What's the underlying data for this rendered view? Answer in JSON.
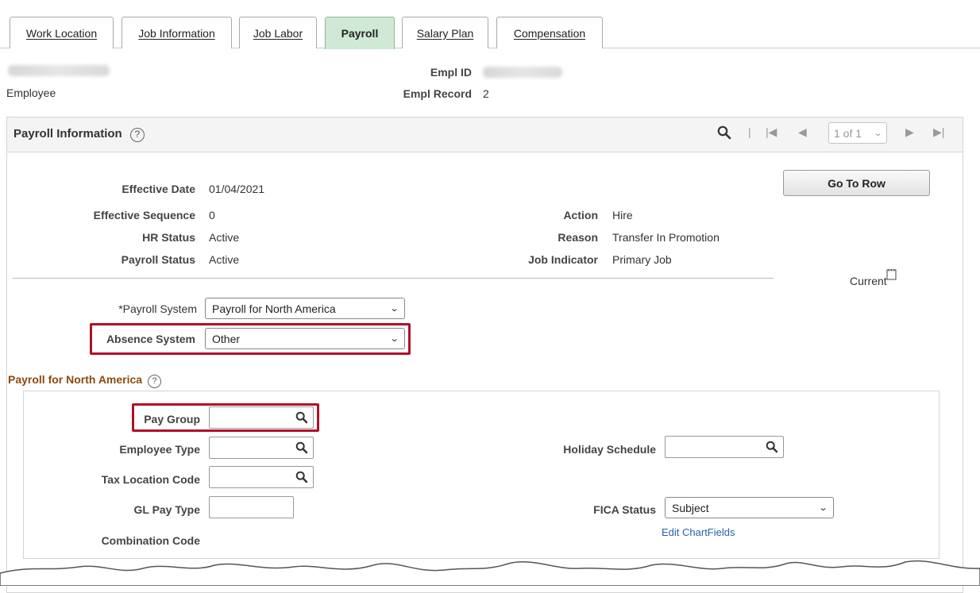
{
  "tabs": [
    {
      "label": "Work Location",
      "active": false
    },
    {
      "label": "Job Information",
      "active": false
    },
    {
      "label": "Job Labor",
      "active": false
    },
    {
      "label": "Payroll",
      "active": true
    },
    {
      "label": "Salary Plan",
      "active": false
    },
    {
      "label": "Compensation",
      "active": false
    }
  ],
  "header": {
    "employee_label": "Employee",
    "empl_id_label": "Empl ID",
    "empl_record_label": "Empl Record",
    "empl_record_value": "2"
  },
  "panel": {
    "title": "Payroll Information",
    "help": "?",
    "pager": "1 of 1",
    "go_to_row": "Go To Row",
    "effective_date_label": "Effective Date",
    "effective_date": "01/04/2021",
    "effective_sequence_label": "Effective Sequence",
    "effective_sequence": "0",
    "hr_status_label": "HR Status",
    "hr_status": "Active",
    "payroll_status_label": "Payroll Status",
    "payroll_status": "Active",
    "action_label": "Action",
    "action": "Hire",
    "reason_label": "Reason",
    "reason": "Transfer In Promotion",
    "job_indicator_label": "Job Indicator",
    "job_indicator": "Primary Job",
    "current_label": "Current",
    "payroll_system_label": "*Payroll System",
    "payroll_system": "Payroll for North America",
    "absence_system_label": "Absence System",
    "absence_system": "Other"
  },
  "pna": {
    "title": "Payroll for North America",
    "pay_group_label": "Pay Group",
    "employee_type_label": "Employee Type",
    "tax_location_label": "Tax Location Code",
    "gl_pay_type_label": "GL Pay Type",
    "combination_code_label": "Combination Code",
    "holiday_schedule_label": "Holiday Schedule",
    "fica_status_label": "FICA Status",
    "fica_status": "Subject",
    "edit_chartfields": "Edit ChartFields"
  },
  "colors": {
    "active_tab": "#cfe9d6",
    "highlight": "#b0102a",
    "section_title": "#8b4a10",
    "link": "#2761b5"
  }
}
